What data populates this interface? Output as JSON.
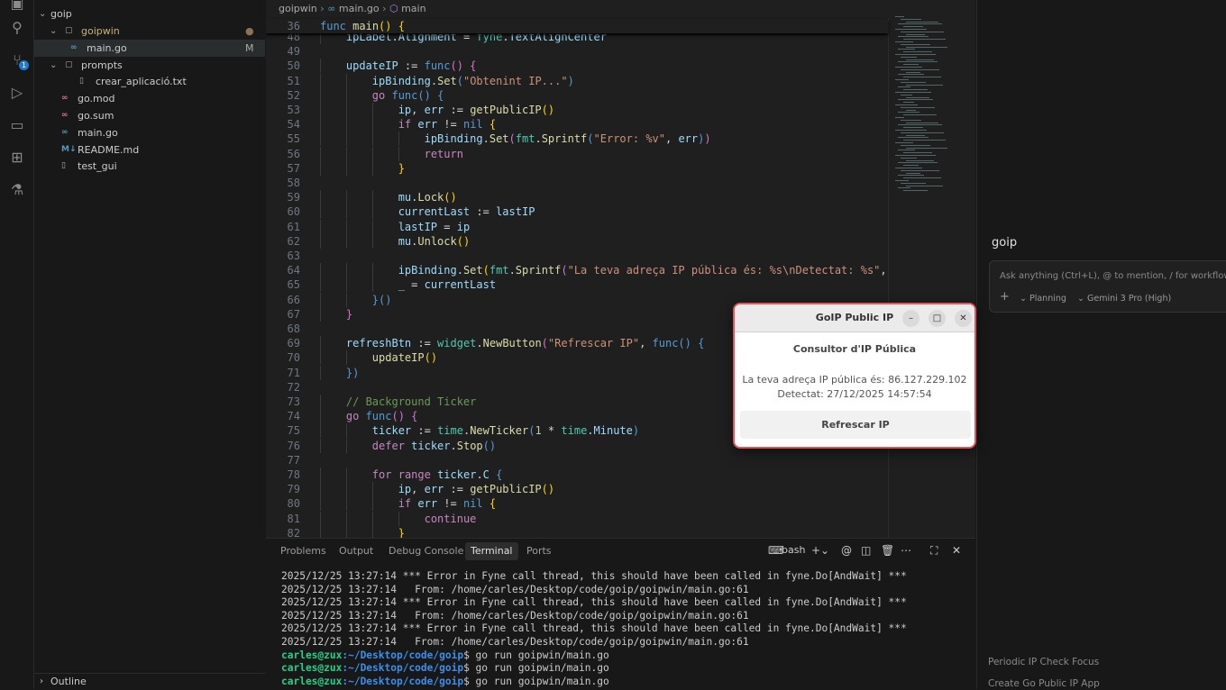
{
  "activity_bar": {
    "items": [
      "explorer-icon",
      "search-icon",
      "source-control-icon",
      "run-debug-icon",
      "remote-explorer-icon",
      "extensions-icon",
      "testing-icon"
    ],
    "scm_badge": "1"
  },
  "explorer": {
    "root": "goip",
    "items": [
      {
        "label": "goipwin",
        "type": "folder",
        "depth": 1,
        "status": "●"
      },
      {
        "label": "main.go",
        "type": "go",
        "depth": 2,
        "status": "M",
        "selected": true
      },
      {
        "label": "prompts",
        "type": "folder",
        "depth": 1,
        "status": ""
      },
      {
        "label": "crear_aplicació.txt",
        "type": "file",
        "depth": 2,
        "status": ""
      },
      {
        "label": "go.mod",
        "type": "gomod",
        "depth": 1,
        "status": ""
      },
      {
        "label": "go.sum",
        "type": "gomod",
        "depth": 1,
        "status": ""
      },
      {
        "label": "main.go",
        "type": "go",
        "depth": 1,
        "status": ""
      },
      {
        "label": "README.md",
        "type": "md",
        "depth": 1,
        "status": ""
      },
      {
        "label": "test_gui",
        "type": "file",
        "depth": 1,
        "status": ""
      }
    ],
    "outline": "Outline"
  },
  "editor": {
    "breadcrumb": [
      "goipwin",
      "main.go",
      "main"
    ],
    "sticky": {
      "n": "36",
      "indent": 0,
      "t": [
        [
          "func",
          "b"
        ],
        [
          " "
        ],
        [
          "main",
          "f"
        ],
        [
          "()",
          "y"
        ],
        [
          " "
        ],
        [
          "{",
          "y"
        ]
      ]
    },
    "lines": [
      {
        "n": "48",
        "indent": 1,
        "t": [
          [
            "ipLabel",
            "v"
          ],
          [
            ".",
            "w"
          ],
          [
            "Alignment",
            "v"
          ],
          [
            " = ",
            "w"
          ],
          [
            "fyne",
            "t"
          ],
          [
            ".",
            "w"
          ],
          [
            "TextAlignCenter",
            "v"
          ]
        ]
      },
      {
        "n": "49",
        "indent": 0,
        "t": []
      },
      {
        "n": "50",
        "indent": 1,
        "t": [
          [
            "updateIP",
            "v"
          ],
          [
            " := ",
            "w"
          ],
          [
            "func",
            "b"
          ],
          [
            "()",
            "p"
          ],
          [
            " {",
            "p"
          ]
        ]
      },
      {
        "n": "51",
        "indent": 2,
        "t": [
          [
            "ipBinding",
            "v"
          ],
          [
            ".",
            "w"
          ],
          [
            "Set",
            "f"
          ],
          [
            "(",
            "b"
          ],
          [
            "\"Obtenint IP...\"",
            "s"
          ],
          [
            ")",
            "b"
          ]
        ]
      },
      {
        "n": "52",
        "indent": 2,
        "t": [
          [
            "go",
            "k"
          ],
          [
            " "
          ],
          [
            "func",
            "b"
          ],
          [
            "()",
            "b"
          ],
          [
            " {",
            "b"
          ]
        ]
      },
      {
        "n": "53",
        "indent": 3,
        "t": [
          [
            "ip",
            "v"
          ],
          [
            ", ",
            "w"
          ],
          [
            "err",
            "v"
          ],
          [
            " := ",
            "w"
          ],
          [
            "getPublicIP",
            "f"
          ],
          [
            "()",
            "y"
          ]
        ]
      },
      {
        "n": "54",
        "indent": 3,
        "t": [
          [
            "if",
            "k"
          ],
          [
            " "
          ],
          [
            "err",
            "v"
          ],
          [
            " != ",
            "w"
          ],
          [
            "nil",
            "b"
          ],
          [
            " {",
            "y"
          ]
        ]
      },
      {
        "n": "55",
        "indent": 4,
        "t": [
          [
            "ipBinding",
            "v"
          ],
          [
            ".",
            "w"
          ],
          [
            "Set",
            "f"
          ],
          [
            "(",
            "p"
          ],
          [
            "fmt",
            "t"
          ],
          [
            ".",
            "w"
          ],
          [
            "Sprintf",
            "f"
          ],
          [
            "(",
            "b"
          ],
          [
            "\"Error: %v\"",
            "s"
          ],
          [
            ", ",
            "w"
          ],
          [
            "err",
            "v"
          ],
          [
            ")",
            "b"
          ],
          [
            ")",
            "p"
          ]
        ]
      },
      {
        "n": "56",
        "indent": 4,
        "t": [
          [
            "return",
            "k"
          ]
        ]
      },
      {
        "n": "57",
        "indent": 3,
        "t": [
          [
            "}",
            "y"
          ]
        ]
      },
      {
        "n": "58",
        "indent": 0,
        "t": []
      },
      {
        "n": "59",
        "indent": 3,
        "t": [
          [
            "mu",
            "v"
          ],
          [
            ".",
            "w"
          ],
          [
            "Lock",
            "f"
          ],
          [
            "()",
            "y"
          ]
        ]
      },
      {
        "n": "60",
        "indent": 3,
        "t": [
          [
            "currentLast",
            "v"
          ],
          [
            " := ",
            "w"
          ],
          [
            "lastIP",
            "v"
          ]
        ]
      },
      {
        "n": "61",
        "indent": 3,
        "t": [
          [
            "lastIP",
            "v"
          ],
          [
            " = ",
            "w"
          ],
          [
            "ip",
            "v"
          ]
        ]
      },
      {
        "n": "62",
        "indent": 3,
        "t": [
          [
            "mu",
            "v"
          ],
          [
            ".",
            "w"
          ],
          [
            "Unlock",
            "f"
          ],
          [
            "()",
            "y"
          ]
        ]
      },
      {
        "n": "63",
        "indent": 0,
        "t": []
      },
      {
        "n": "64",
        "indent": 3,
        "t": [
          [
            "ipBinding",
            "v"
          ],
          [
            ".",
            "w"
          ],
          [
            "Set",
            "f"
          ],
          [
            "(",
            "y"
          ],
          [
            "fmt",
            "t"
          ],
          [
            ".",
            "w"
          ],
          [
            "Sprintf",
            "f"
          ],
          [
            "(",
            "p"
          ],
          [
            "\"La teva adreça IP pública és: %s\\nDetectat: %s\"",
            "s"
          ],
          [
            ",",
            "w"
          ]
        ]
      },
      {
        "n": "65",
        "indent": 3,
        "t": [
          [
            "_",
            "v"
          ],
          [
            " = ",
            "w"
          ],
          [
            "currentLast",
            "v"
          ]
        ]
      },
      {
        "n": "66",
        "indent": 2,
        "t": [
          [
            "}()",
            "b"
          ]
        ]
      },
      {
        "n": "67",
        "indent": 1,
        "t": [
          [
            "}",
            "p"
          ]
        ]
      },
      {
        "n": "68",
        "indent": 0,
        "t": []
      },
      {
        "n": "69",
        "indent": 1,
        "t": [
          [
            "refreshBtn",
            "v"
          ],
          [
            " := ",
            "w"
          ],
          [
            "widget",
            "t"
          ],
          [
            ".",
            "w"
          ],
          [
            "NewButton",
            "f"
          ],
          [
            "(",
            "p"
          ],
          [
            "\"Refrescar IP\"",
            "s"
          ],
          [
            ", ",
            "w"
          ],
          [
            "func",
            "b"
          ],
          [
            "()",
            "b"
          ],
          [
            " {",
            "b"
          ]
        ]
      },
      {
        "n": "70",
        "indent": 2,
        "t": [
          [
            "updateIP",
            "f"
          ],
          [
            "()",
            "y"
          ]
        ]
      },
      {
        "n": "71",
        "indent": 1,
        "t": [
          [
            "})",
            "b"
          ]
        ]
      },
      {
        "n": "72",
        "indent": 0,
        "t": []
      },
      {
        "n": "73",
        "indent": 1,
        "t": [
          [
            "// Background Ticker",
            "c"
          ]
        ]
      },
      {
        "n": "74",
        "indent": 1,
        "t": [
          [
            "go",
            "k"
          ],
          [
            " "
          ],
          [
            "func",
            "b"
          ],
          [
            "()",
            "p"
          ],
          [
            " {",
            "p"
          ]
        ]
      },
      {
        "n": "75",
        "indent": 2,
        "t": [
          [
            "ticker",
            "v"
          ],
          [
            " := ",
            "w"
          ],
          [
            "time",
            "t"
          ],
          [
            ".",
            "w"
          ],
          [
            "NewTicker",
            "f"
          ],
          [
            "(",
            "b"
          ],
          [
            "1",
            "n"
          ],
          [
            " * ",
            "w"
          ],
          [
            "time",
            "t"
          ],
          [
            ".",
            "w"
          ],
          [
            "Minute",
            "v"
          ],
          [
            ")",
            "b"
          ]
        ]
      },
      {
        "n": "76",
        "indent": 2,
        "t": [
          [
            "defer",
            "k"
          ],
          [
            " "
          ],
          [
            "ticker",
            "v"
          ],
          [
            ".",
            "w"
          ],
          [
            "Stop",
            "f"
          ],
          [
            "()",
            "b"
          ]
        ]
      },
      {
        "n": "77",
        "indent": 0,
        "t": []
      },
      {
        "n": "78",
        "indent": 2,
        "t": [
          [
            "for",
            "k"
          ],
          [
            " "
          ],
          [
            "range",
            "k"
          ],
          [
            " "
          ],
          [
            "ticker",
            "v"
          ],
          [
            ".",
            "w"
          ],
          [
            "C",
            "v"
          ],
          [
            " {",
            "b"
          ]
        ]
      },
      {
        "n": "79",
        "indent": 3,
        "t": [
          [
            "ip",
            "v"
          ],
          [
            ", ",
            "w"
          ],
          [
            "err",
            "v"
          ],
          [
            " := ",
            "w"
          ],
          [
            "getPublicIP",
            "f"
          ],
          [
            "()",
            "y"
          ]
        ]
      },
      {
        "n": "80",
        "indent": 3,
        "t": [
          [
            "if",
            "k"
          ],
          [
            " "
          ],
          [
            "err",
            "v"
          ],
          [
            " != ",
            "w"
          ],
          [
            "nil",
            "b"
          ],
          [
            " {",
            "y"
          ]
        ]
      },
      {
        "n": "81",
        "indent": 4,
        "t": [
          [
            "continue",
            "k"
          ]
        ]
      },
      {
        "n": "82",
        "indent": 3,
        "t": [
          [
            "}",
            "y"
          ]
        ]
      }
    ]
  },
  "panel": {
    "tabs": [
      "Problems",
      "Output",
      "Debug Console",
      "Terminal",
      "Ports"
    ],
    "active_tab": "Terminal",
    "shell": "bash",
    "terminal": [
      {
        "text": "2025/12/25 13:27:14 *** Error in Fyne call thread, this should have been called in fyne.Do[AndWait] ***"
      },
      {
        "text": "2025/12/25 13:27:14   From: /home/carles/Desktop/code/goip/goipwin/main.go:61"
      },
      {
        "text": "2025/12/25 13:27:14 *** Error in Fyne call thread, this should have been called in fyne.Do[AndWait] ***"
      },
      {
        "text": "2025/12/25 13:27:14   From: /home/carles/Desktop/code/goip/goipwin/main.go:61"
      },
      {
        "text": "2025/12/25 13:27:14 *** Error in Fyne call thread, this should have been called in fyne.Do[AndWait] ***"
      },
      {
        "text": "2025/12/25 13:27:14   From: /home/carles/Desktop/code/goip/goipwin/main.go:61"
      },
      {
        "user": "carles@zux",
        "path": ":~/Desktop/code/goip",
        "cmd": "$ go run goipwin/main.go"
      },
      {
        "user": "carles@zux",
        "path": ":~/Desktop/code/goip",
        "cmd": "$ go run goipwin/main.go"
      },
      {
        "user": "carles@zux",
        "path": ":~/Desktop/code/goip",
        "cmd": "$ go run goipwin/main.go"
      }
    ]
  },
  "agent_panel": {
    "title": "goip",
    "input_placeholder": "Ask anything (Ctrl+L), @ to mention, / for workflows",
    "mode": "Planning",
    "model": "Gemini 3 Pro (High)",
    "history": [
      "Periodic IP Check Focus",
      "Create Go Public IP App"
    ]
  },
  "dialog": {
    "title": "GoIP Public IP",
    "heading": "Consultor d'IP Pública",
    "line1": "La teva adreça IP pública és: 86.127.229.102",
    "line2": "Detectat: 27/12/2025 14:57:54",
    "button": "Refrescar IP",
    "border_color": "#e0555a"
  }
}
